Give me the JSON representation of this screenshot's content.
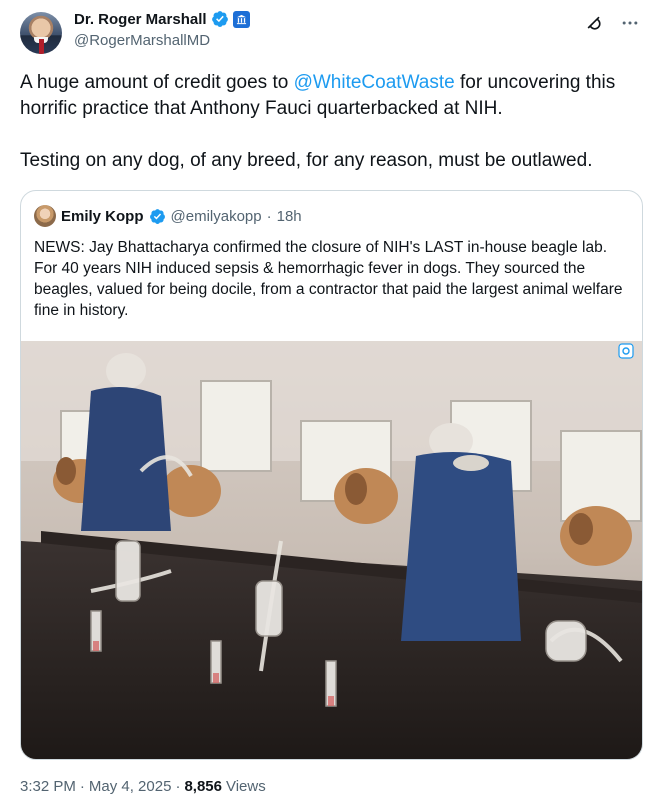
{
  "author": {
    "name": "Dr. Roger Marshall",
    "handle": "@RogerMarshallMD"
  },
  "icons": {
    "verified": "verified-badge-icon",
    "government": "government-badge-icon",
    "grok": "grok-icon",
    "more": "more-icon",
    "alt": "expand-icon"
  },
  "tweet": {
    "line1_before": "A huge amount of credit goes to ",
    "mention": "@WhiteCoatWaste",
    "line1_after": " for uncovering this horrific practice that Anthony Fauci quarterbacked at NIH.",
    "paragraph2": "Testing on any dog, of any breed, for any reason, must be outlawed."
  },
  "quote": {
    "name": "Emily Kopp",
    "handle": "@emilyakopp",
    "separator": "·",
    "time": "18h",
    "text": "NEWS: Jay Bhattacharya confirmed the closure of NIH's LAST in-house beagle lab. For 40 years NIH induced sepsis & hemorrhagic fever in dogs. They sourced the beagles, valued for being docile, from a contractor that paid the largest animal welfare fine in history."
  },
  "footer": {
    "time": "3:32 PM",
    "dot1": "·",
    "date": "May 4, 2025",
    "dot2": "·",
    "views_count": "8,856",
    "views_label": "Views"
  },
  "colors": {
    "accent": "#1d9bf0",
    "text": "#0f1419",
    "secondary": "#536471",
    "border": "#cfd9de"
  }
}
